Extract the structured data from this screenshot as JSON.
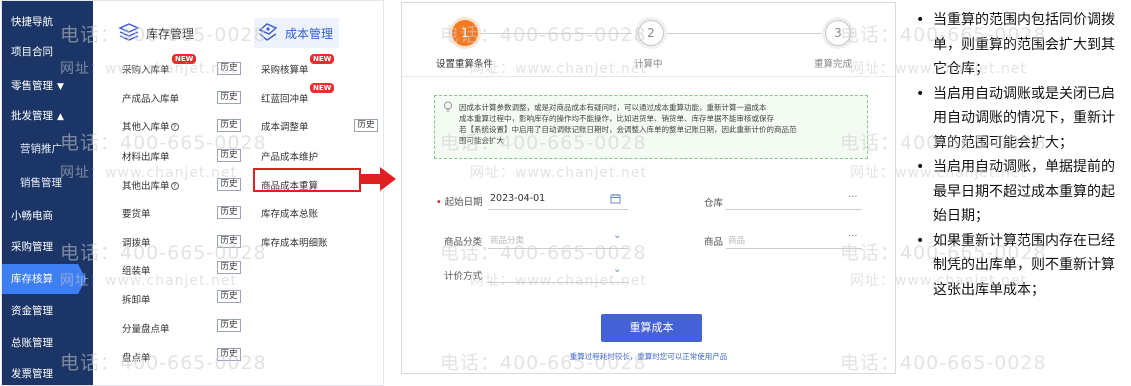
{
  "sidebar": {
    "items": [
      {
        "label": "快捷导航"
      },
      {
        "label": "项目合同"
      },
      {
        "label": "零售管理",
        "arrow": "▼"
      },
      {
        "label": "批发管理",
        "arrow": "▲"
      },
      {
        "label": "营销推广"
      },
      {
        "label": "销售管理"
      },
      {
        "label": "小畅电商"
      },
      {
        "label": "采购管理"
      },
      {
        "label": "库存核算",
        "active": true
      },
      {
        "label": "资金管理"
      },
      {
        "label": "总账管理"
      },
      {
        "label": "发票管理"
      }
    ]
  },
  "menu": {
    "inventory_header": "库存管理",
    "cost_header": "成本管理",
    "history_label": "历史",
    "new_badge": "NEW",
    "inventory_items": [
      {
        "label": "采购入库单"
      },
      {
        "label": "产成品入库单"
      },
      {
        "label": "其他入库单"
      },
      {
        "label": "材料出库单"
      },
      {
        "label": "其他出库单"
      },
      {
        "label": "要货单"
      },
      {
        "label": "调拨单"
      },
      {
        "label": "组装单"
      },
      {
        "label": "拆卸单"
      },
      {
        "label": "分量盘点单"
      },
      {
        "label": "盘点单"
      }
    ],
    "cost_items": [
      {
        "label": "采购核算单"
      },
      {
        "label": "红蓝回冲单"
      },
      {
        "label": "成本调整单"
      },
      {
        "label": "产品成本维护"
      },
      {
        "label": "商品成本重算"
      },
      {
        "label": "库存成本总账"
      },
      {
        "label": "库存成本明细账"
      }
    ]
  },
  "dialog": {
    "steps": [
      {
        "number": "1",
        "label": "设置重算条件"
      },
      {
        "number": "2",
        "label": "计算中"
      },
      {
        "number": "3",
        "label": "重算完成"
      }
    ],
    "notice_lines": [
      "因成本计算参数调整，或是对商品成本有疑问时，可以通过成本重算功能，重新计算一遍成本",
      "成本重算过程中，影响库存的操作均不能操作，比如进货单、销货单、库存单据不能审核或保存",
      "若【系统设置】中启用了自动调账记账日期时，会调整入库单的整单记账日期，因此重新计价的商品范",
      "围可能会扩大"
    ],
    "fields": {
      "start_date_label": "起始日期",
      "start_date_value": "2023-04-01",
      "warehouse_label": "仓库",
      "category_label": "商品分类",
      "category_placeholder": "商品分类",
      "product_label": "商品",
      "product_placeholder": "商品",
      "pricing_label": "计价方式"
    },
    "button_label": "重算成本",
    "footer_note": "重算过程耗时较长，重算时您可以正常使用产品"
  },
  "notes": [
    "当重算的范围内包括同价调拨单，则重算的范围会扩大到其它仓库；",
    "当启用自动调账或是关闭已启用自动调账的情况下，重新计算的范围可能会扩大；",
    "当启用自动调账，单据提前的最早日期不超过成本重算的起始日期；",
    "如果重新计算范围内存在已经制凭的出库单，则不重新计算这张出库单成本；"
  ],
  "watermark": {
    "phone": "电话：400-665-0028",
    "site": "网址：www.chanjet.net"
  },
  "colors": {
    "sidebar": "#1b3566",
    "sidebar_active": "#3e7ef3",
    "step_active": "#f47920",
    "primary_button": "#4561d6",
    "highlight": "#e02020"
  }
}
